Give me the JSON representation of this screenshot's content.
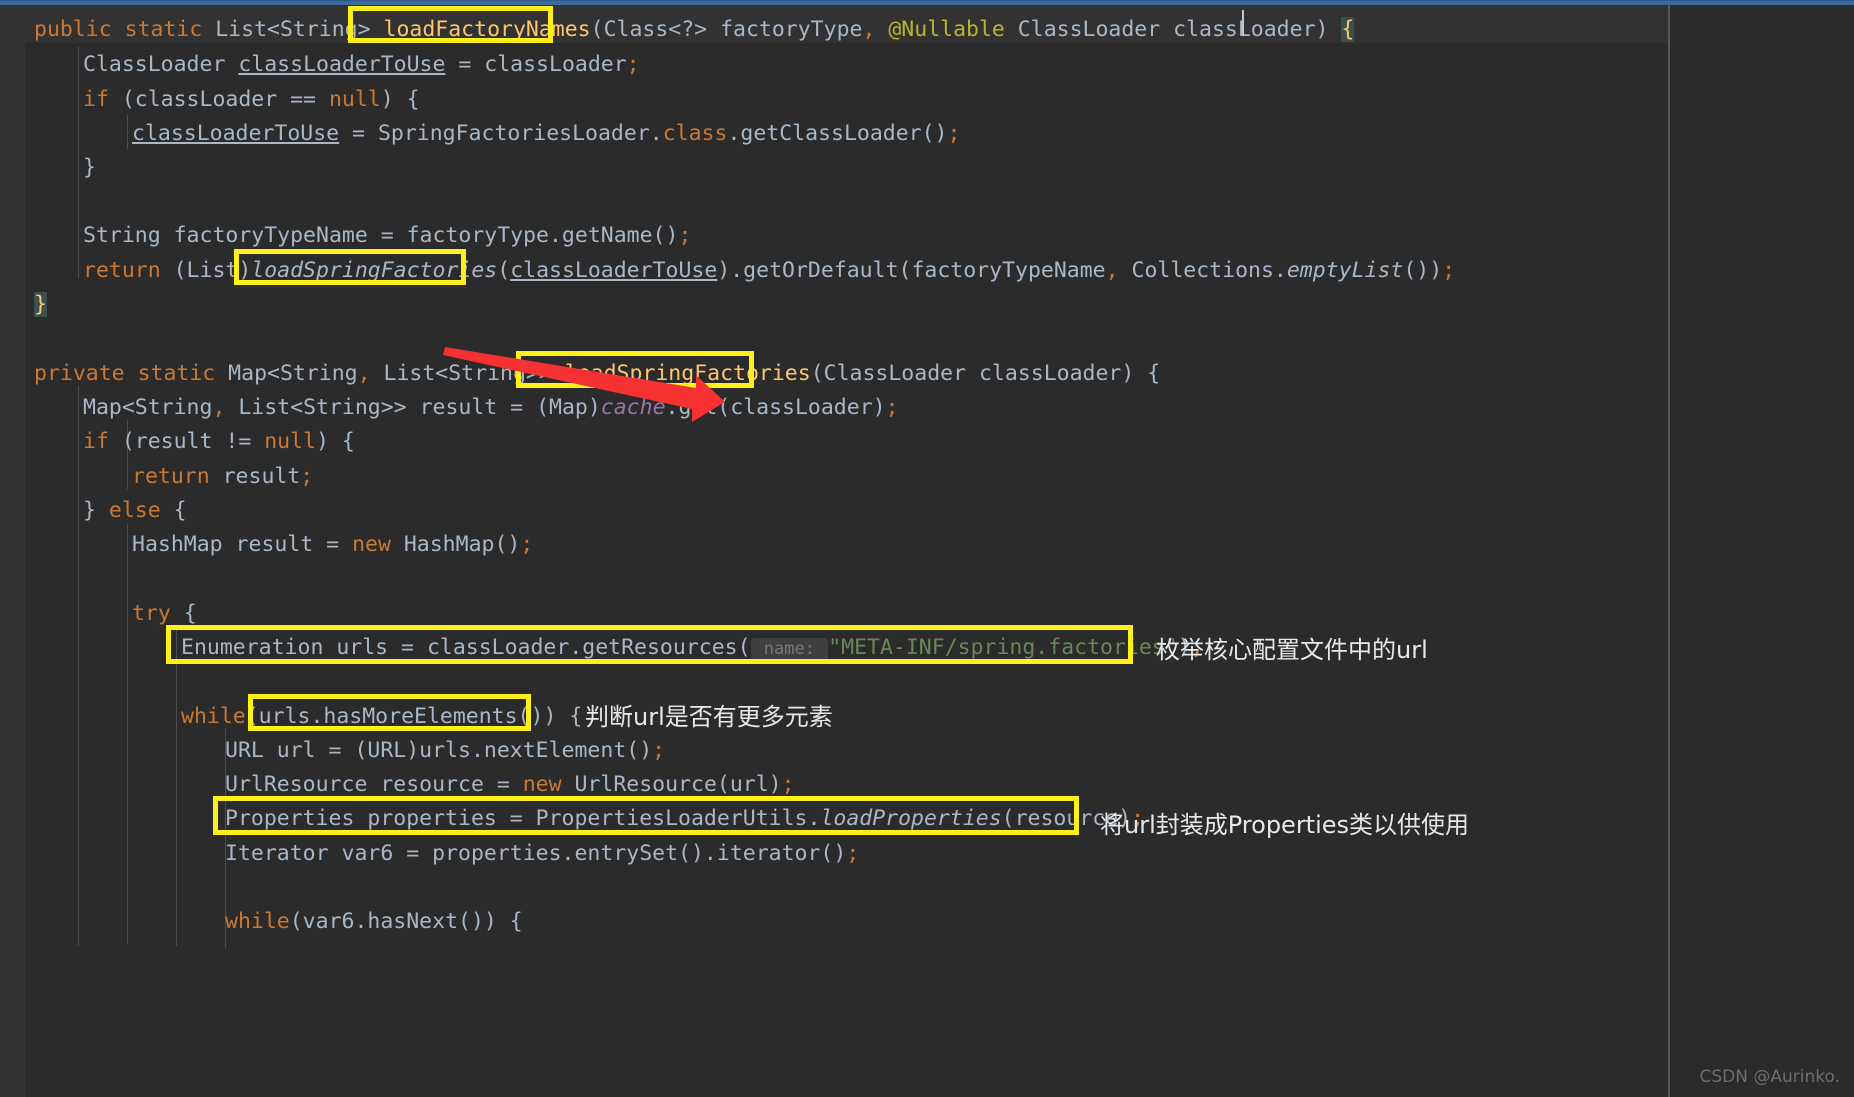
{
  "editor": {
    "theme": "darcula",
    "background_color": "#2b2b2b",
    "gutter_color": "#313335",
    "caret_line_color": "#323232",
    "default_text_color": "#a9b7c6",
    "highlight_box_color": "#fcf018",
    "arrow_color": "#f03030",
    "note_text_color": "#e8e8e8",
    "top_accent_color": "#3c6a9a"
  },
  "code_lines": [
    {
      "indent": 0,
      "text": "public static List<String> loadFactoryNames(Class<?> factoryType, @Nullable ClassLoader classLoader) {"
    },
    {
      "indent": 1,
      "text": "ClassLoader classLoaderToUse = classLoader;"
    },
    {
      "indent": 1,
      "text": "if (classLoader == null) {"
    },
    {
      "indent": 2,
      "text": "classLoaderToUse = SpringFactoriesLoader.class.getClassLoader();"
    },
    {
      "indent": 1,
      "text": "}"
    },
    {
      "indent": 0,
      "text": ""
    },
    {
      "indent": 1,
      "text": "String factoryTypeName = factoryType.getName();"
    },
    {
      "indent": 1,
      "text": "return (List)loadSpringFactories(classLoaderToUse).getOrDefault(factoryTypeName, Collections.emptyList());"
    },
    {
      "indent": 0,
      "text": "}"
    },
    {
      "indent": 0,
      "text": ""
    },
    {
      "indent": 0,
      "text": "private static Map<String, List<String>> loadSpringFactories(ClassLoader classLoader) {"
    },
    {
      "indent": 1,
      "text": "Map<String, List<String>> result = (Map)cache.get(classLoader);"
    },
    {
      "indent": 1,
      "text": "if (result != null) {"
    },
    {
      "indent": 2,
      "text": "return result;"
    },
    {
      "indent": 1,
      "text": "} else {"
    },
    {
      "indent": 2,
      "text": "HashMap result = new HashMap();"
    },
    {
      "indent": 0,
      "text": ""
    },
    {
      "indent": 2,
      "text": "try {"
    },
    {
      "indent": 3,
      "text": "Enumeration urls = classLoader.getResources( name: \"META-INF/spring.factories\");"
    },
    {
      "indent": 0,
      "text": ""
    },
    {
      "indent": 3,
      "text": "while(urls.hasMoreElements()) {"
    },
    {
      "indent": 4,
      "text": "URL url = (URL)urls.nextElement();"
    },
    {
      "indent": 4,
      "text": "UrlResource resource = new UrlResource(url);"
    },
    {
      "indent": 4,
      "text": "Properties properties = PropertiesLoaderUtils.loadProperties(resource);"
    },
    {
      "indent": 4,
      "text": "Iterator var6 = properties.entrySet().iterator();"
    },
    {
      "indent": 0,
      "text": ""
    },
    {
      "indent": 4,
      "text": "while(var6.hasNext()) {"
    }
  ],
  "highlight_boxes": [
    {
      "name": "loadFactoryNames",
      "label": "loadFactoryNames"
    },
    {
      "name": "loadSpringFactories-call",
      "label": "loadSpringFactories"
    },
    {
      "name": "loadSpringFactories-decl",
      "label": "loadSpringFactories"
    },
    {
      "name": "enumeration-urls",
      "label": "Enumeration urls = classLoader.getResources( name: \"META-INF/spring.factories\");"
    },
    {
      "name": "urls-hasmoreelements",
      "label": "urls.hasMoreElements())"
    },
    {
      "name": "properties-load",
      "label": "Properties properties = PropertiesLoaderUtils.loadProperties(resource);"
    }
  ],
  "annotations": [
    {
      "id": "note-enumerate-url",
      "text": "枚举核心配置文件中的url"
    },
    {
      "id": "note-has-more",
      "text": "判断url是否有更多元素"
    },
    {
      "id": "note-wrap-properties",
      "text": "将url封装成Properties类以供使用"
    }
  ],
  "watermark": {
    "text": "CSDN @Aurinko."
  }
}
